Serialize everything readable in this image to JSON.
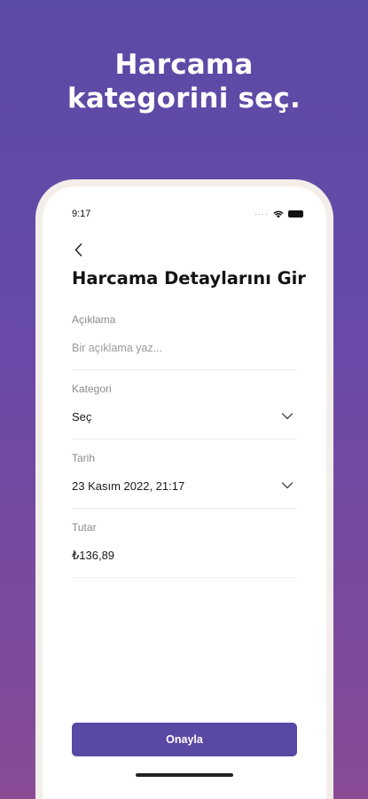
{
  "promo": {
    "headline_line1": "Harcama",
    "headline_line2": "kategorini seç."
  },
  "status_bar": {
    "time": "9:17",
    "signal_dots": "····"
  },
  "screen": {
    "title": "Harcama Detaylarını Gir",
    "fields": {
      "description": {
        "label": "Açıklama",
        "placeholder": "Bir açıklama yaz..."
      },
      "category": {
        "label": "Kategori",
        "value": "Seç"
      },
      "date": {
        "label": "Tarih",
        "value": "23 Kasım 2022, 21:17"
      },
      "amount": {
        "label": "Tutar",
        "value": "₺136,89"
      }
    },
    "confirm_label": "Onayla"
  },
  "icons": {
    "back": "chevron-left-icon",
    "dropdown": "chevron-down-icon",
    "wifi": "wifi-icon",
    "battery": "battery-icon"
  },
  "colors": {
    "background_top": "#5b4aa6",
    "background_bottom": "#8a4b95",
    "accent": "#5a48a5"
  }
}
